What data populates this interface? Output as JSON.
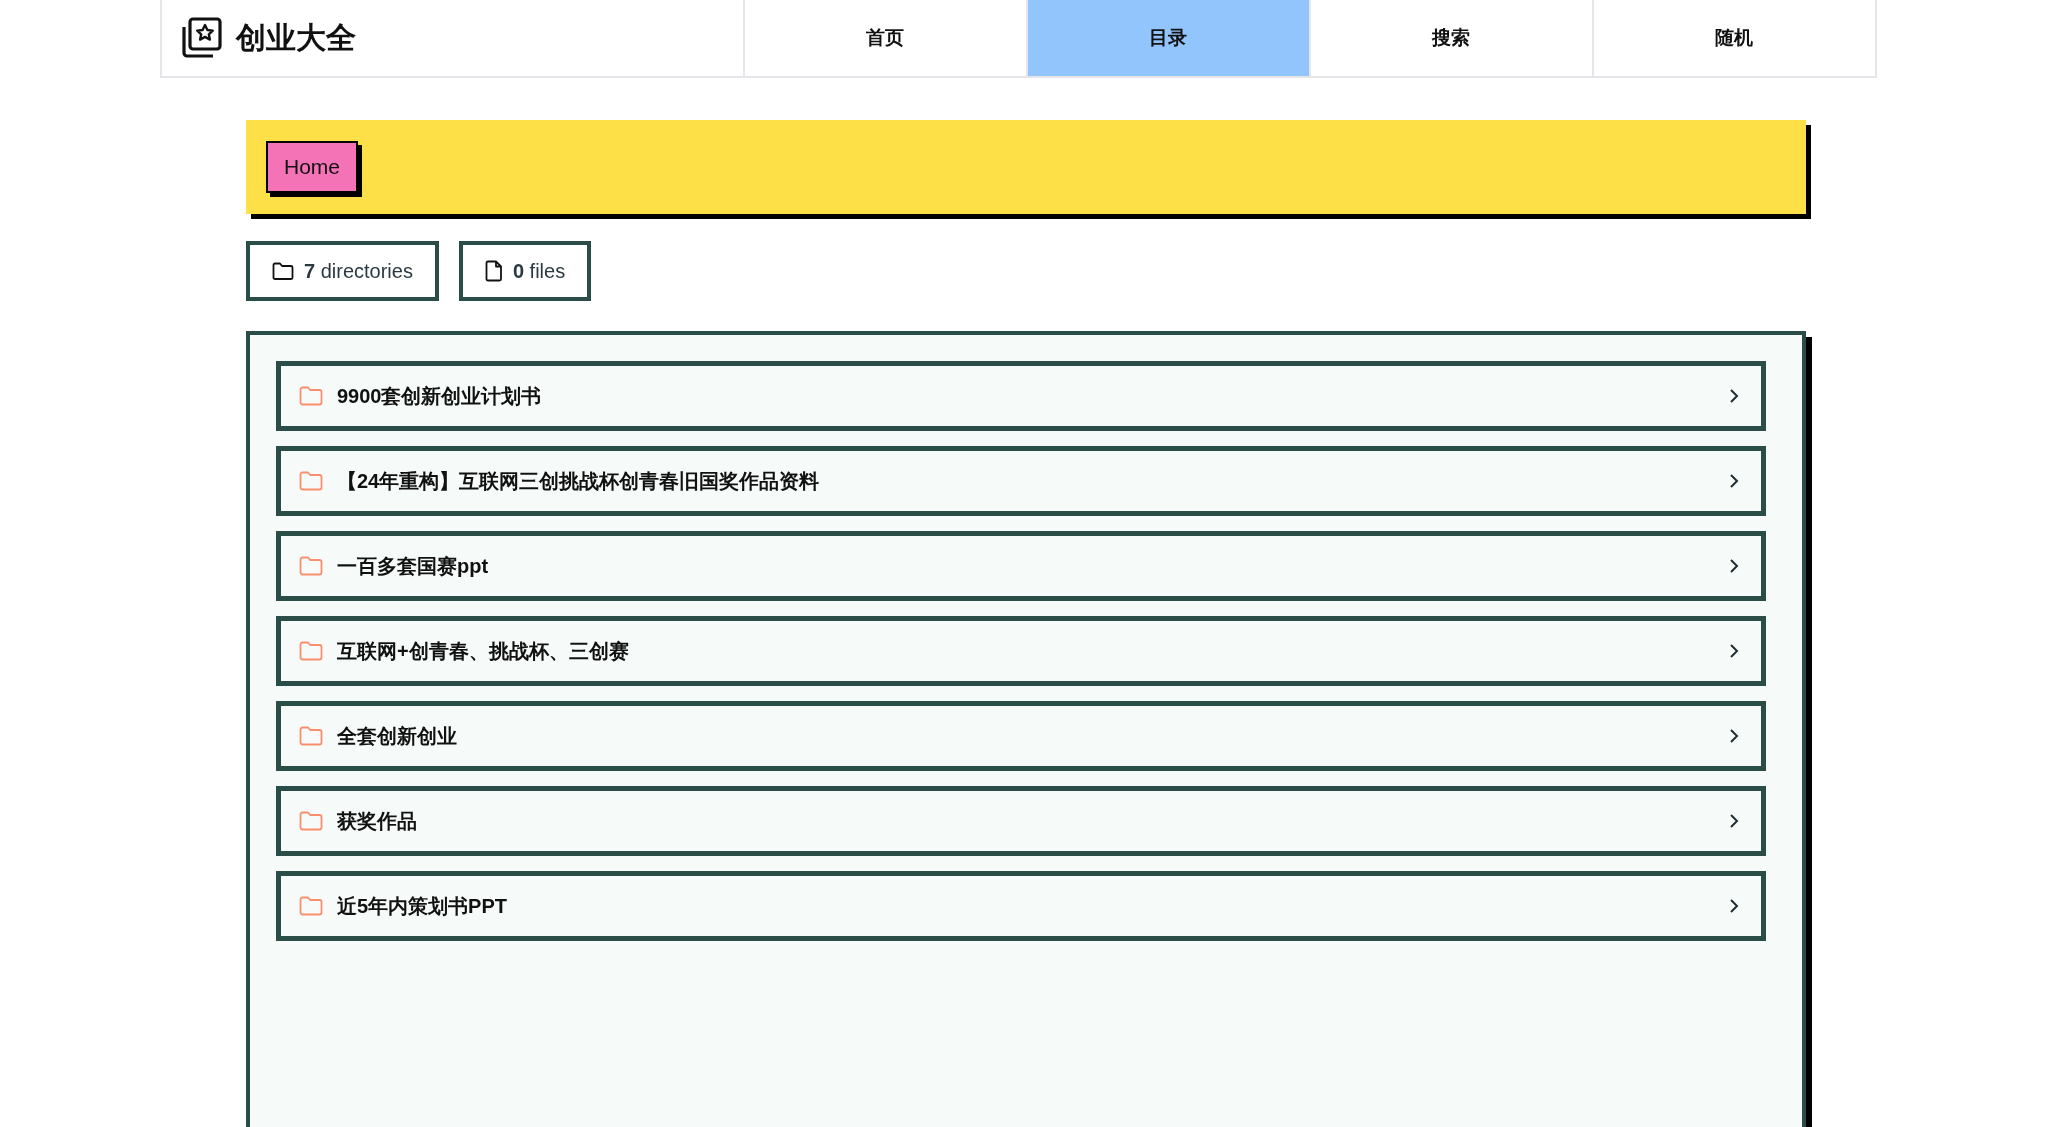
{
  "header": {
    "title": "创业大全",
    "nav": [
      {
        "label": "首页",
        "selected": false
      },
      {
        "label": "目录",
        "selected": true
      },
      {
        "label": "搜索",
        "selected": false
      },
      {
        "label": "随机",
        "selected": false
      }
    ]
  },
  "breadcrumb": [
    "Home"
  ],
  "counts": [
    {
      "kind": "folder",
      "text": "**7** directories"
    },
    {
      "kind": "file",
      "text": "**0** files"
    }
  ],
  "directories": [
    {
      "name": "9900套创新创业计划书"
    },
    {
      "name": "【24年重构】互联网三创挑战杯创青春旧国奖作品资料"
    },
    {
      "name": "一百多套国赛ppt"
    },
    {
      "name": "互联网+创青春、挑战杯、三创赛"
    },
    {
      "name": "全套创新创业"
    },
    {
      "name": "获奖作品"
    },
    {
      "name": "近5年内策划书PPT"
    }
  ]
}
